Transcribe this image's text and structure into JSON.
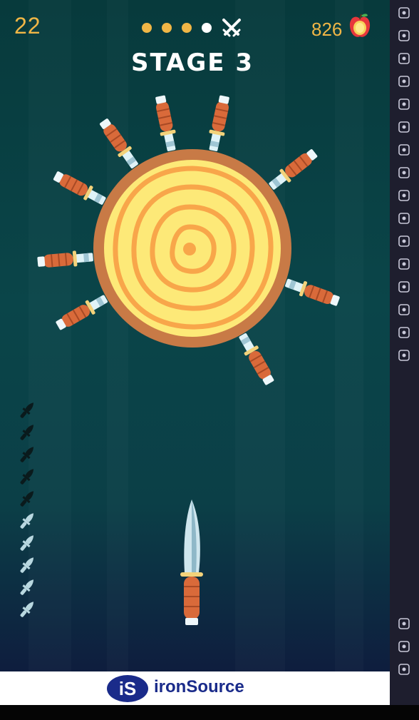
{
  "hud": {
    "score": "22",
    "stage_dots": 5,
    "current_dot_index": 3,
    "boss_icon": "crossed-swords-icon",
    "apples": "826",
    "apple_icon": "apple-icon"
  },
  "stage": {
    "title": "STAGE 3"
  },
  "target": {
    "type": "wooden-log",
    "stuck_knife_angles_deg": [
      150,
      175,
      208,
      235,
      258,
      282,
      322,
      20,
      60
    ]
  },
  "knife_queue": {
    "total": 10,
    "used": 5
  },
  "player_knife": {
    "icon": "knife-icon"
  },
  "ad": {
    "logo_text": "iS",
    "brand": "ironSource"
  },
  "sidebar": {
    "buttons": [
      "fullscreen-icon",
      "volume-up-icon",
      "volume-down-icon",
      "cursor-icon",
      "keyboard-icon",
      "play-record-icon",
      "rotate-icon",
      "gamepad-icon",
      "apk-icon",
      "screenshot-icon",
      "folder-icon",
      "multi-window-icon",
      "erase-icon",
      "layers-icon",
      "speed-icon",
      "settings-icon",
      "back-icon",
      "home-icon",
      "recent-apps-icon"
    ]
  },
  "colors": {
    "accent": "#f0b646",
    "bg_top": "#073a3c",
    "bg_bottom": "#0e1d3e",
    "log_rim": "#c87a46",
    "log_center": "#fde978",
    "handle": "#d96a3a"
  }
}
